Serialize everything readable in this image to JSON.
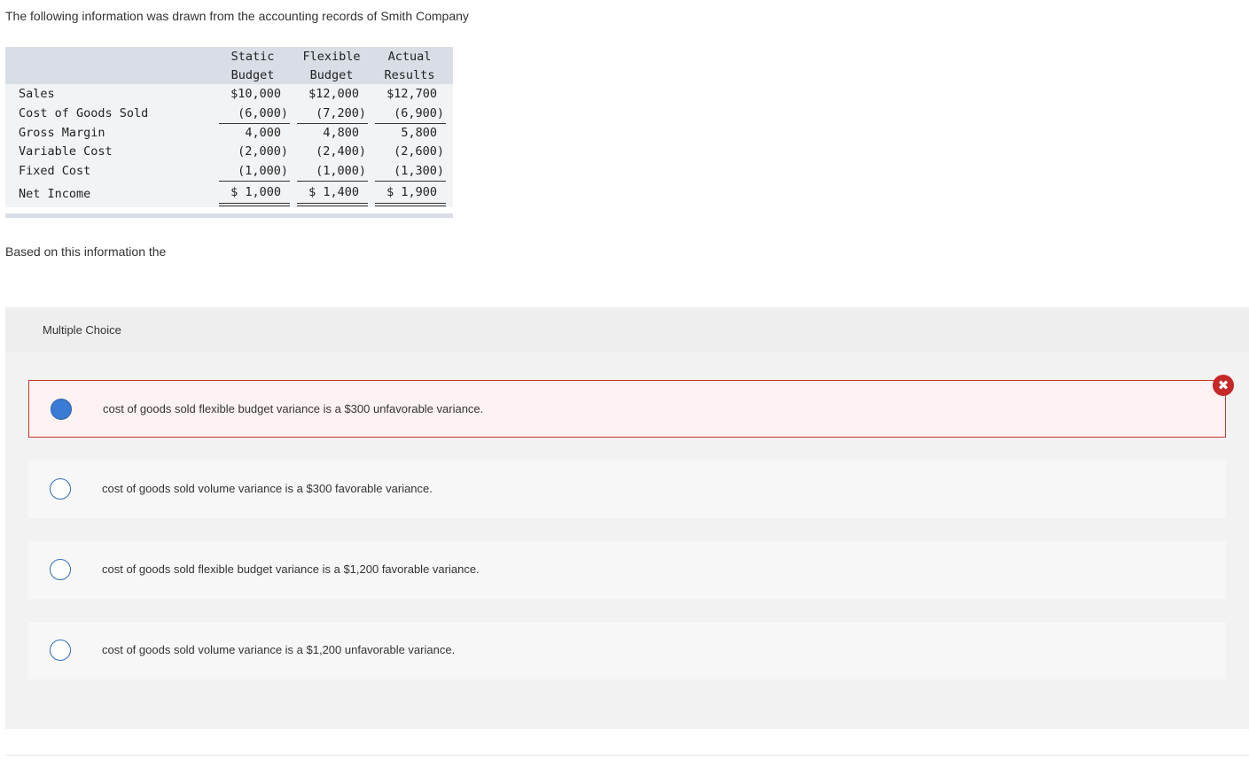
{
  "intro": "The following information was drawn from the accounting records of Smith Company",
  "table": {
    "headers": [
      {
        "line1": "Static",
        "line2": "Budget"
      },
      {
        "line1": "Flexible",
        "line2": "Budget"
      },
      {
        "line1": "Actual",
        "line2": "Results"
      }
    ],
    "rows": [
      {
        "label": "Sales",
        "values": [
          "$10,000",
          "$12,000",
          "$12,700"
        ]
      },
      {
        "label": "Cost of Goods Sold",
        "values": [
          "(6,000)",
          "(7,200)",
          "(6,900)"
        ]
      },
      {
        "label": "Gross Margin",
        "values": [
          "4,000",
          "4,800",
          "5,800"
        ]
      },
      {
        "label": "Variable Cost",
        "values": [
          "(2,000)",
          "(2,400)",
          "(2,600)"
        ]
      },
      {
        "label": "Fixed Cost",
        "values": [
          "(1,000)",
          "(1,000)",
          "(1,300)"
        ]
      },
      {
        "label": "Net Income",
        "values": [
          "$ 1,000",
          "$ 1,400",
          "$ 1,900"
        ]
      }
    ]
  },
  "prompt": "Based on this information the",
  "multiple_choice": {
    "title": "Multiple Choice",
    "options": [
      {
        "text": "cost of goods sold flexible budget variance is a $300 unfavorable variance.",
        "selected": true,
        "marked_incorrect": true
      },
      {
        "text": "cost of goods sold volume variance is a $300 favorable variance.",
        "selected": false
      },
      {
        "text": "cost of goods sold flexible budget variance is a $1,200 favorable variance.",
        "selected": false
      },
      {
        "text": "cost of goods sold volume variance is a $1,200 unfavorable variance.",
        "selected": false
      }
    ],
    "incorrect_icon": "close-icon"
  },
  "colors": {
    "selected_border": "#c0392b",
    "radio_fill": "#3a7bd5",
    "incorrect_badge": "#c62828"
  }
}
